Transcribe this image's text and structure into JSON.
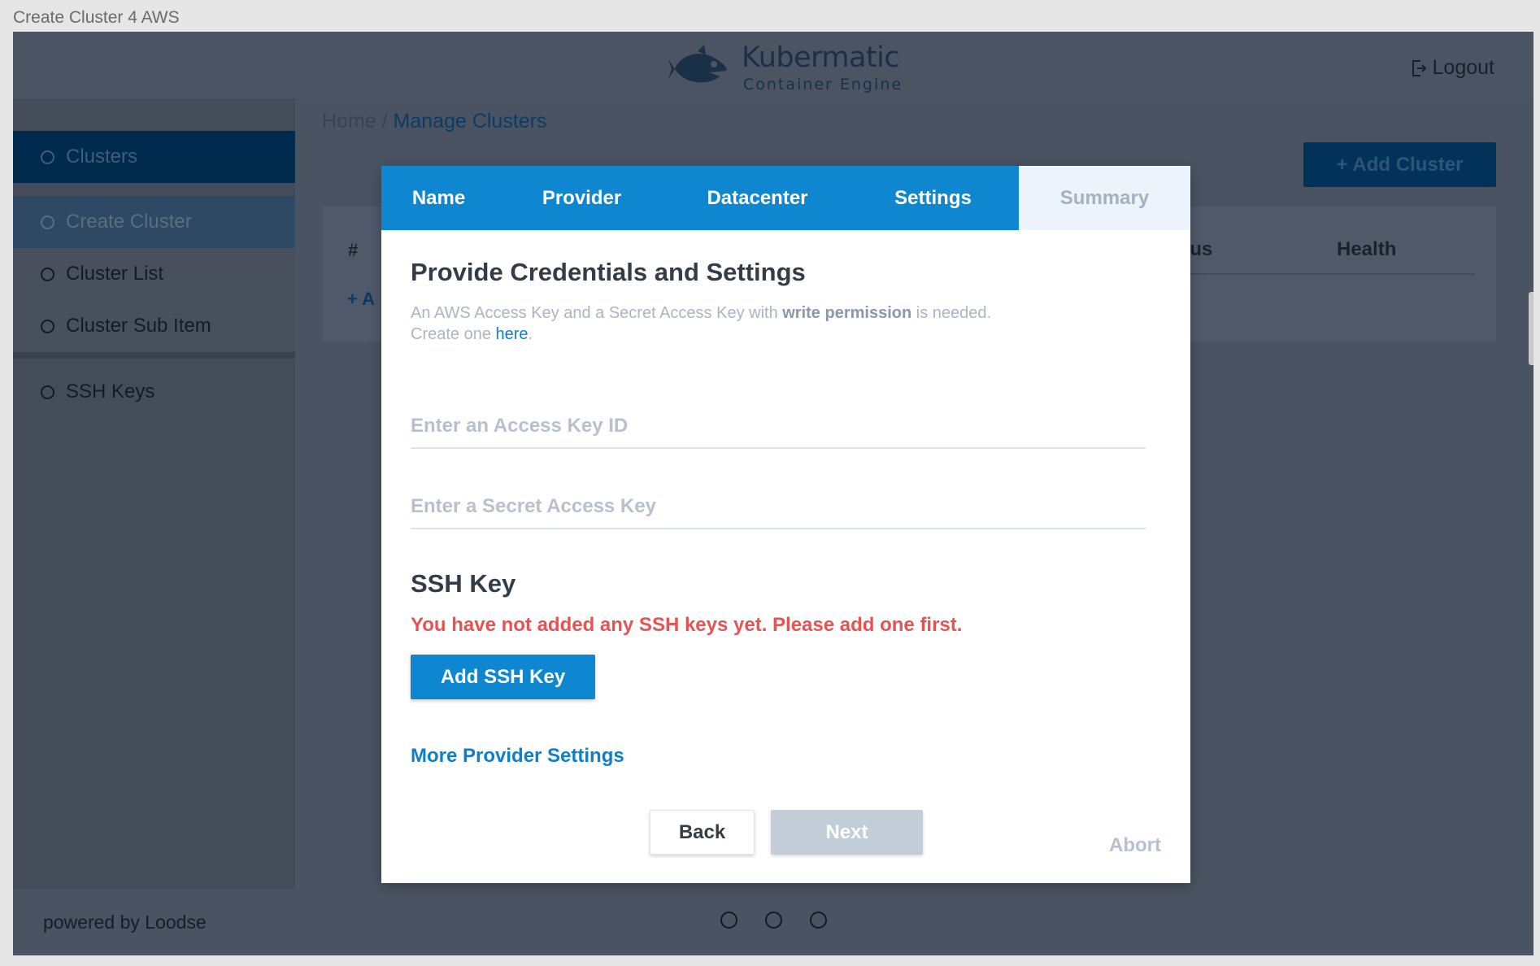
{
  "window": {
    "title": "Create Cluster 4 AWS"
  },
  "header": {
    "logo_title": "Kubermatic",
    "logo_subtitle": "Container Engine",
    "logout_label": "Logout"
  },
  "sidebar": {
    "items": [
      {
        "label": "Clusters"
      },
      {
        "label": "Create Cluster"
      },
      {
        "label": "Cluster List"
      },
      {
        "label": "Cluster Sub Item"
      },
      {
        "label": "SSH Keys"
      }
    ]
  },
  "main": {
    "breadcrumb": {
      "home": "Home",
      "separator": " / ",
      "current": "Manage Clusters"
    },
    "add_cluster_label": "+ Add Cluster",
    "table": {
      "col_hash": "#",
      "col_status": "tatus",
      "col_health": "Health",
      "add_row": "+ A"
    }
  },
  "modal": {
    "tabs": [
      {
        "label": "Name"
      },
      {
        "label": "Provider"
      },
      {
        "label": "Datacenter"
      },
      {
        "label": "Settings"
      },
      {
        "label": "Summary"
      }
    ],
    "title": "Provide Credentials and Settings",
    "desc_part1": "An AWS Access Key and a Secret Access Key with ",
    "desc_bold": "write permission",
    "desc_part2": " is needed.",
    "desc_line2_pre": "Create one ",
    "desc_link": "here",
    "desc_line2_post": ".",
    "access_key": {
      "placeholder": "Enter an Access Key ID",
      "value": ""
    },
    "secret_key": {
      "placeholder": "Enter a Secret Access Key",
      "value": ""
    },
    "ssh_title": "SSH Key",
    "ssh_warning": "You have not added any SSH keys yet. Please add one first.",
    "add_ssh_label": "Add SSH Key",
    "more_settings_label": "More Provider Settings",
    "back_label": "Back",
    "next_label": "Next",
    "abort_label": "Abort"
  },
  "footer": {
    "powered": "powered by Loodse"
  },
  "colors": {
    "primary": "#0f87d0",
    "warning": "#e55353",
    "overlay_bg": "#4a5361",
    "disabled": "#c3cdd8"
  }
}
